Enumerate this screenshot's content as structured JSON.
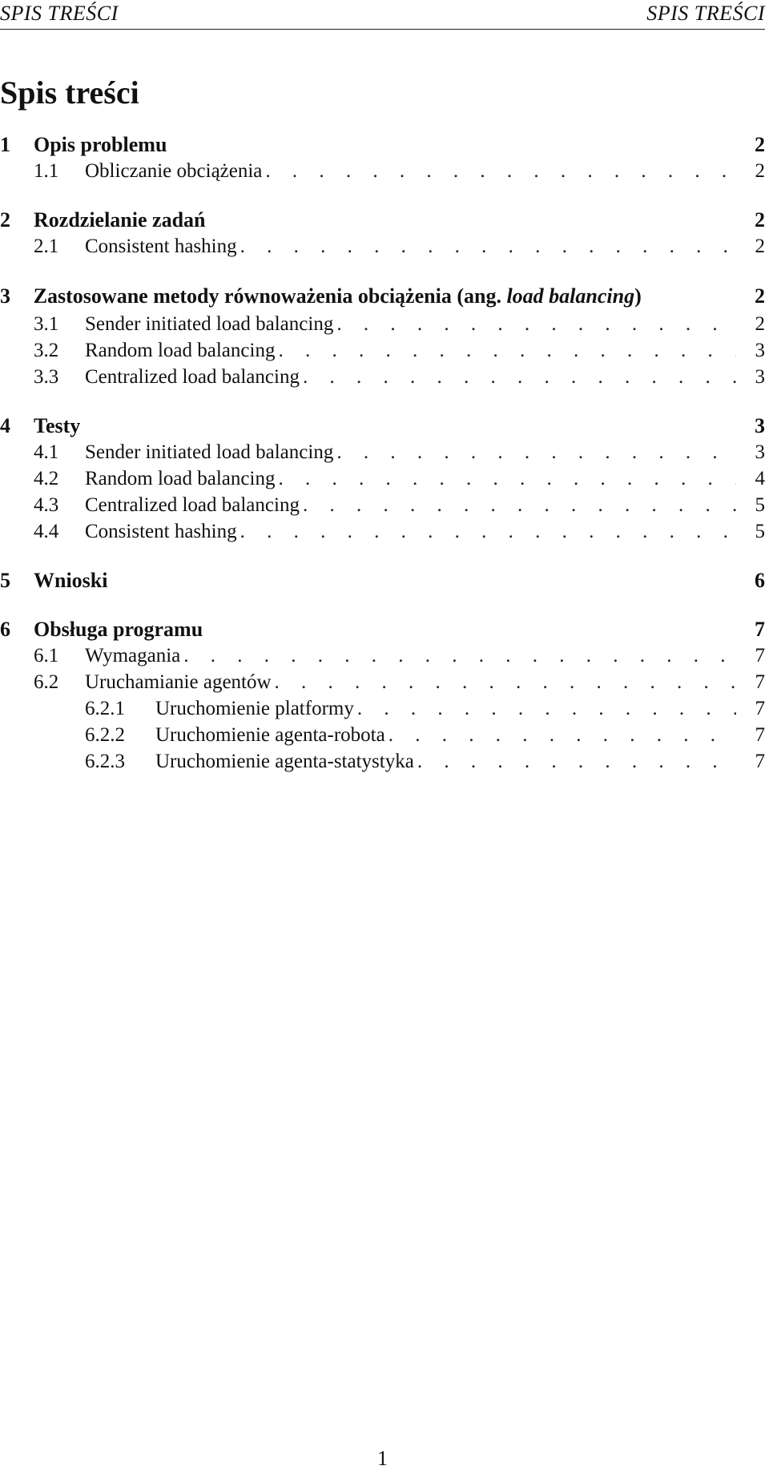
{
  "header": {
    "left": "SPIS TREŚCI",
    "right": "SPIS TREŚCI"
  },
  "toc_title": "Spis treści",
  "dot_leader": ". . . . . . . . . . . . . . . . . . . . . . . . . . . . . . . . . . . . . . . . . . . . . . . .",
  "entries": [
    {
      "level": 1,
      "num": "1",
      "title": "Opis problemu",
      "page": "2"
    },
    {
      "level": 2,
      "num": "1.1",
      "title": "Obliczanie obciążenia",
      "page": "2"
    },
    {
      "level": 1,
      "num": "2",
      "title": "Rozdzielanie zadań",
      "page": "2"
    },
    {
      "level": 2,
      "num": "2.1",
      "title": "Consistent hashing",
      "page": "2"
    },
    {
      "level": 1,
      "num": "3",
      "title_parts": [
        "Zastosowane metody równoważenia obciążenia (ang. ",
        "load balancing",
        ")"
      ],
      "page": "2"
    },
    {
      "level": 2,
      "num": "3.1",
      "title": "Sender initiated load balancing",
      "page": "2"
    },
    {
      "level": 2,
      "num": "3.2",
      "title": "Random load balancing",
      "page": "3"
    },
    {
      "level": 2,
      "num": "3.3",
      "title": "Centralized load balancing",
      "page": "3"
    },
    {
      "level": 1,
      "num": "4",
      "title": "Testy",
      "page": "3"
    },
    {
      "level": 2,
      "num": "4.1",
      "title": "Sender initiated load balancing",
      "page": "3"
    },
    {
      "level": 2,
      "num": "4.2",
      "title": "Random load balancing",
      "page": "4"
    },
    {
      "level": 2,
      "num": "4.3",
      "title": "Centralized load balancing",
      "page": "5"
    },
    {
      "level": 2,
      "num": "4.4",
      "title": "Consistent hashing",
      "page": "5"
    },
    {
      "level": 1,
      "num": "5",
      "title": "Wnioski",
      "page": "6"
    },
    {
      "level": 1,
      "num": "6",
      "title": "Obsługa programu",
      "page": "7"
    },
    {
      "level": 2,
      "num": "6.1",
      "title": "Wymagania",
      "page": "7"
    },
    {
      "level": 2,
      "num": "6.2",
      "title": "Uruchamianie agentów",
      "page": "7"
    },
    {
      "level": 3,
      "num": "6.2.1",
      "title": "Uruchomienie platformy",
      "page": "7"
    },
    {
      "level": 3,
      "num": "6.2.2",
      "title": "Uruchomienie agenta-robota",
      "page": "7"
    },
    {
      "level": 3,
      "num": "6.2.3",
      "title": "Uruchomienie agenta-statystyka",
      "page": "7"
    }
  ],
  "page_number": "1"
}
